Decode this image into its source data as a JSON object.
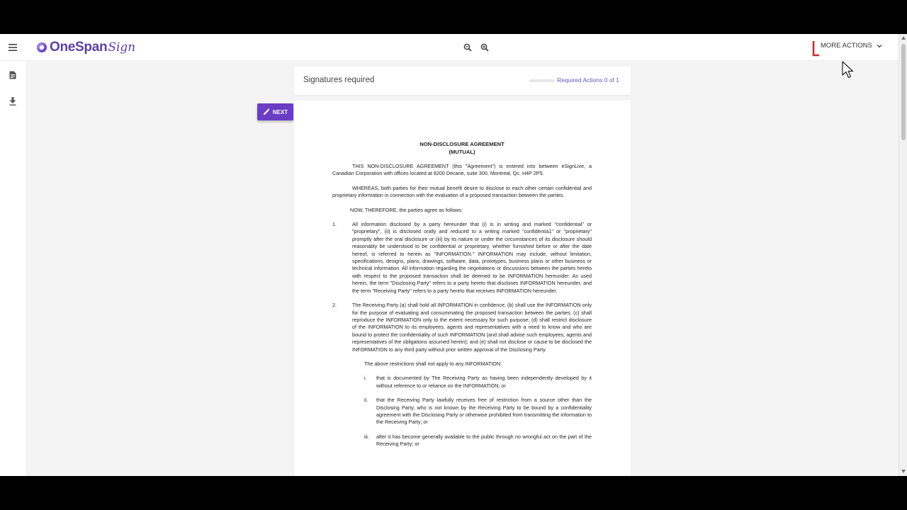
{
  "app": {
    "logo_text": "OneSpan",
    "logo_sign": "Sign"
  },
  "topbar": {
    "more_actions_label": "MORE ACTIONS"
  },
  "header": {
    "title": "Signatures required",
    "required_actions": "Required Actions 0 of 1",
    "progress_value": 0
  },
  "next_button": {
    "label": "NEXT"
  },
  "document": {
    "title_line1": "NON-DISCLOSURE AGREEMENT",
    "title_line2": "(MUTUAL)",
    "p_intro": "THIS NON-DISCLOSURE AGREEMENT (this \"Agreement\") is entered into between eSignLive, a Canadian Corporation with offices located at 8200 Decarie, suite 300, Montreal, Qc. H4P 2P5.",
    "p_whereas": "WHEREAS, both parties for their mutual benefit desire to disclose to each other certain confidential and proprietary information in connection with the evaluation of a proposed transaction between the parties.",
    "p_now": "NOW, THEREFORE, the parties agree as follows:",
    "item1_num": "1.",
    "item1_text": "All information disclosed by a party hereunder that (i) is in writing and marked \"confidential\" or \"proprietary\", (ii) is disclosed orally and reduced to a writing marked \"confidentia1\" or \"proprietary\" promptly after the oral disclosure or (iii) by its nature or under the circumstances of its disclosure should reasonably be understood to be confidential or proprietary, whether furnished before or after the date hereof, is referred to herein as \"INFORMATION.\" INFORMATION may include, without limitation, specifications, designs, plans, drawings, software, data, prototypes, business plans or other business or technical information. All information regarding the negotiations or discussions between the parties hereto with respect to the proposed transaction shall be deemed to be INFORMATION hereunder. As used herein, the term \"Disclosing Party\" refers to a party hereto that discloses INFORMATION hereunder, and the term \"Receiving Party\" refers to a party hereto that receives INFORMATION hereunder.",
    "item2_num": "2.",
    "item2_text": "The Receiving Party (a) shall hold all INFORMATION in confidence; (b) shall use the INFORMATION only for the purpose of evaluating and consummating the proposed transaction between the parties; (c) shall reproduce the INFORMATION only to the extent necessary for such purpose; (d) shall restrict disclosure of the INFORMATION to its employees, agents and representatives with a need to know and who are bound to protect the confidentiality of such INFORMATION (and shall advise such employees, agents and representatives of the obligations assumed herein); and (e) shall not disclose or cause to be disclosed the INFORMATION to any third party without prior written approval of the Disclosing Party.",
    "p_restrictions": "The above restrictions shall not apply to any INFORMATION:",
    "roman_i_num": "i.",
    "roman_i_text": "that is documented by The Receiving Party as having been independently developed by it without reference to or reliance on the INFORMATION; or",
    "roman_ii_num": "ii.",
    "roman_ii_text": "that the Receiving Party lawfully receives free of restriction from a source other than the Disclosing Party, who is not known by the Receiving Party to be bound by a confidentiality agreement with the Disclosing Party or otherwise prohibited from transmitting the information to the Receiving Party; or",
    "roman_iii_num": "iii.",
    "roman_iii_text": "after it has become generally available to the public through no wrongful act on the part of the Receiving Party; or"
  },
  "icons": {
    "menu": "hamburger-menu-icon",
    "documents": "document-icon",
    "download": "download-icon",
    "zoom_out": "zoom-out-icon",
    "zoom_in": "zoom-in-icon",
    "pen": "pen-icon",
    "chevron": "chevron-down-icon"
  },
  "colors": {
    "brand": "#6a3dc2",
    "link": "#5a5ad0",
    "annotation_red": "#d9262c"
  }
}
